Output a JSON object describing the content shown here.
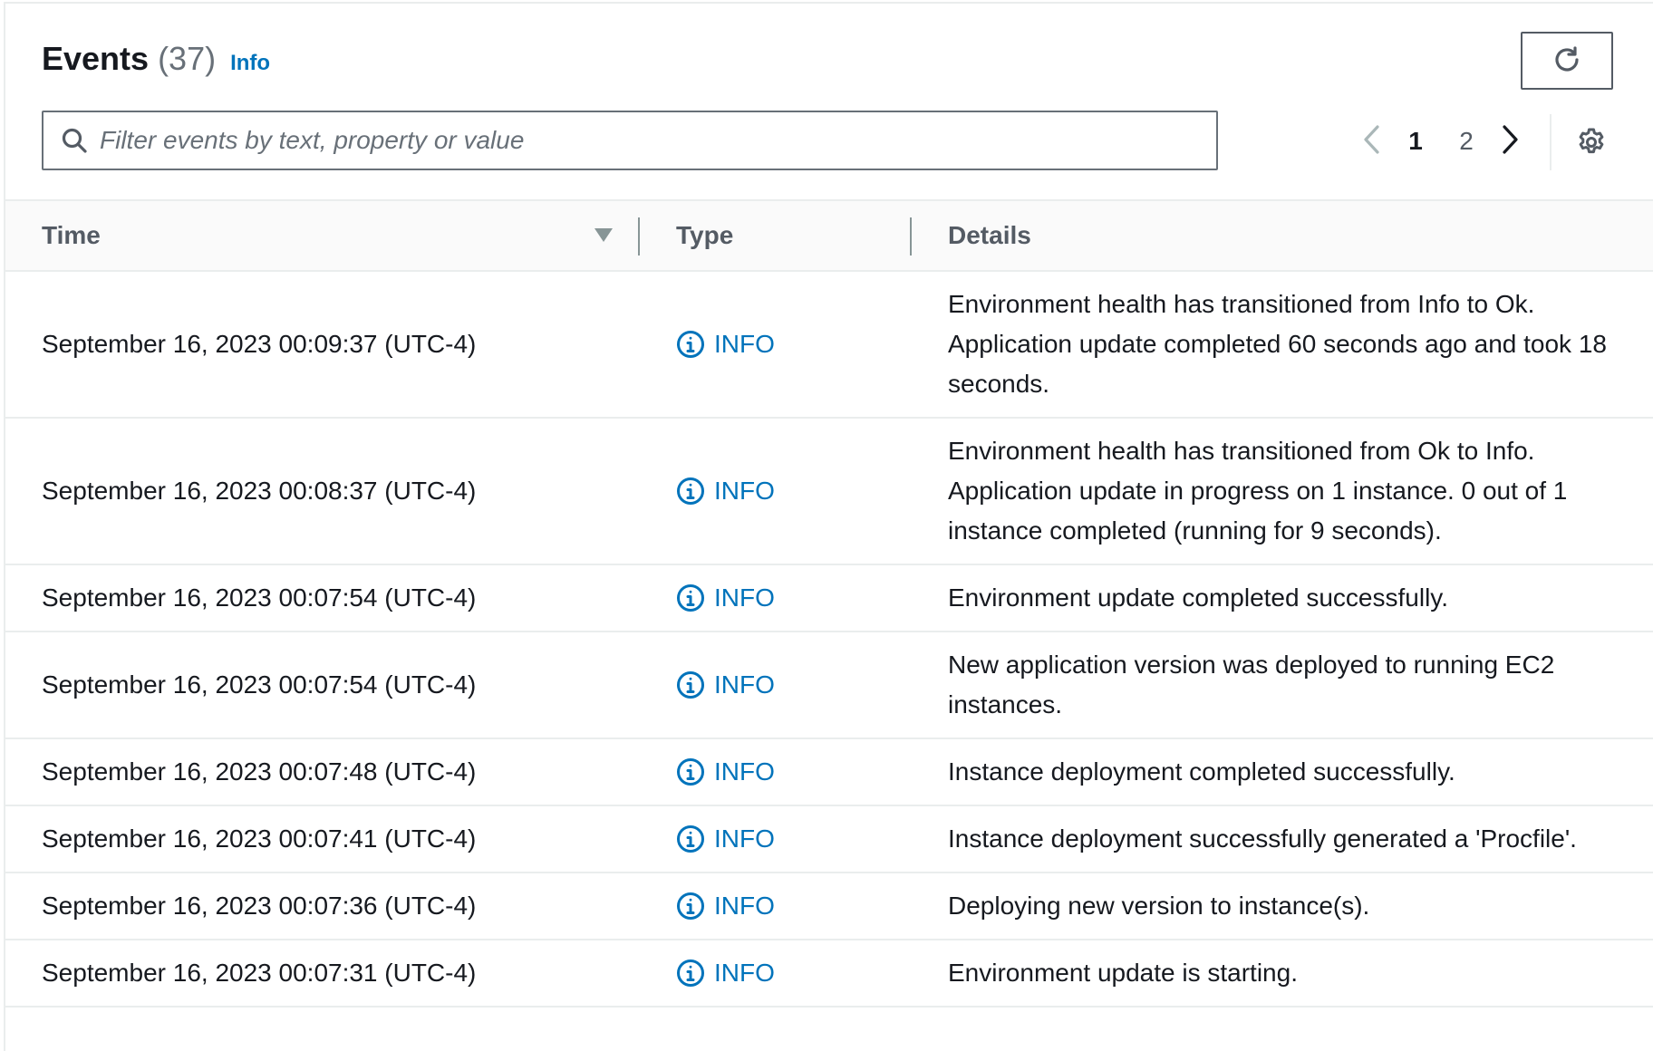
{
  "header": {
    "title": "Events",
    "count": "(37)",
    "info_link": "Info"
  },
  "search": {
    "placeholder": "Filter events by text, property or value",
    "value": ""
  },
  "pagination": {
    "pages": [
      "1",
      "2"
    ],
    "current": "1"
  },
  "table": {
    "columns": {
      "time": "Time",
      "type": "Type",
      "details": "Details"
    },
    "sort": {
      "column": "Time",
      "direction": "descending"
    },
    "rows": [
      {
        "time": "September 16, 2023 00:09:37 (UTC-4)",
        "type": "INFO",
        "details": "Environment health has transitioned from Info to Ok. Application update completed 60 seconds ago and took 18 seconds."
      },
      {
        "time": "September 16, 2023 00:08:37 (UTC-4)",
        "type": "INFO",
        "details": "Environment health has transitioned from Ok to Info. Application update in progress on 1 instance. 0 out of 1 instance completed (running for 9 seconds)."
      },
      {
        "time": "September 16, 2023 00:07:54 (UTC-4)",
        "type": "INFO",
        "details": "Environment update completed successfully."
      },
      {
        "time": "September 16, 2023 00:07:54 (UTC-4)",
        "type": "INFO",
        "details": "New application version was deployed to running EC2 instances."
      },
      {
        "time": "September 16, 2023 00:07:48 (UTC-4)",
        "type": "INFO",
        "details": "Instance deployment completed successfully."
      },
      {
        "time": "September 16, 2023 00:07:41 (UTC-4)",
        "type": "INFO",
        "details": "Instance deployment successfully generated a 'Procfile'."
      },
      {
        "time": "September 16, 2023 00:07:36 (UTC-4)",
        "type": "INFO",
        "details": "Deploying new version to instance(s)."
      },
      {
        "time": "September 16, 2023 00:07:31 (UTC-4)",
        "type": "INFO",
        "details": "Environment update is starting."
      }
    ]
  },
  "icons": {
    "refresh": "refresh-icon",
    "search": "search-icon",
    "prev": "chevron-left-icon",
    "next": "chevron-right-icon",
    "settings": "gear-icon",
    "sort": "caret-down-icon",
    "type": "info-circle-icon"
  },
  "colors": {
    "link": "#0073bb",
    "text": "#16191f",
    "muted": "#687078",
    "border": "#eaeded"
  }
}
